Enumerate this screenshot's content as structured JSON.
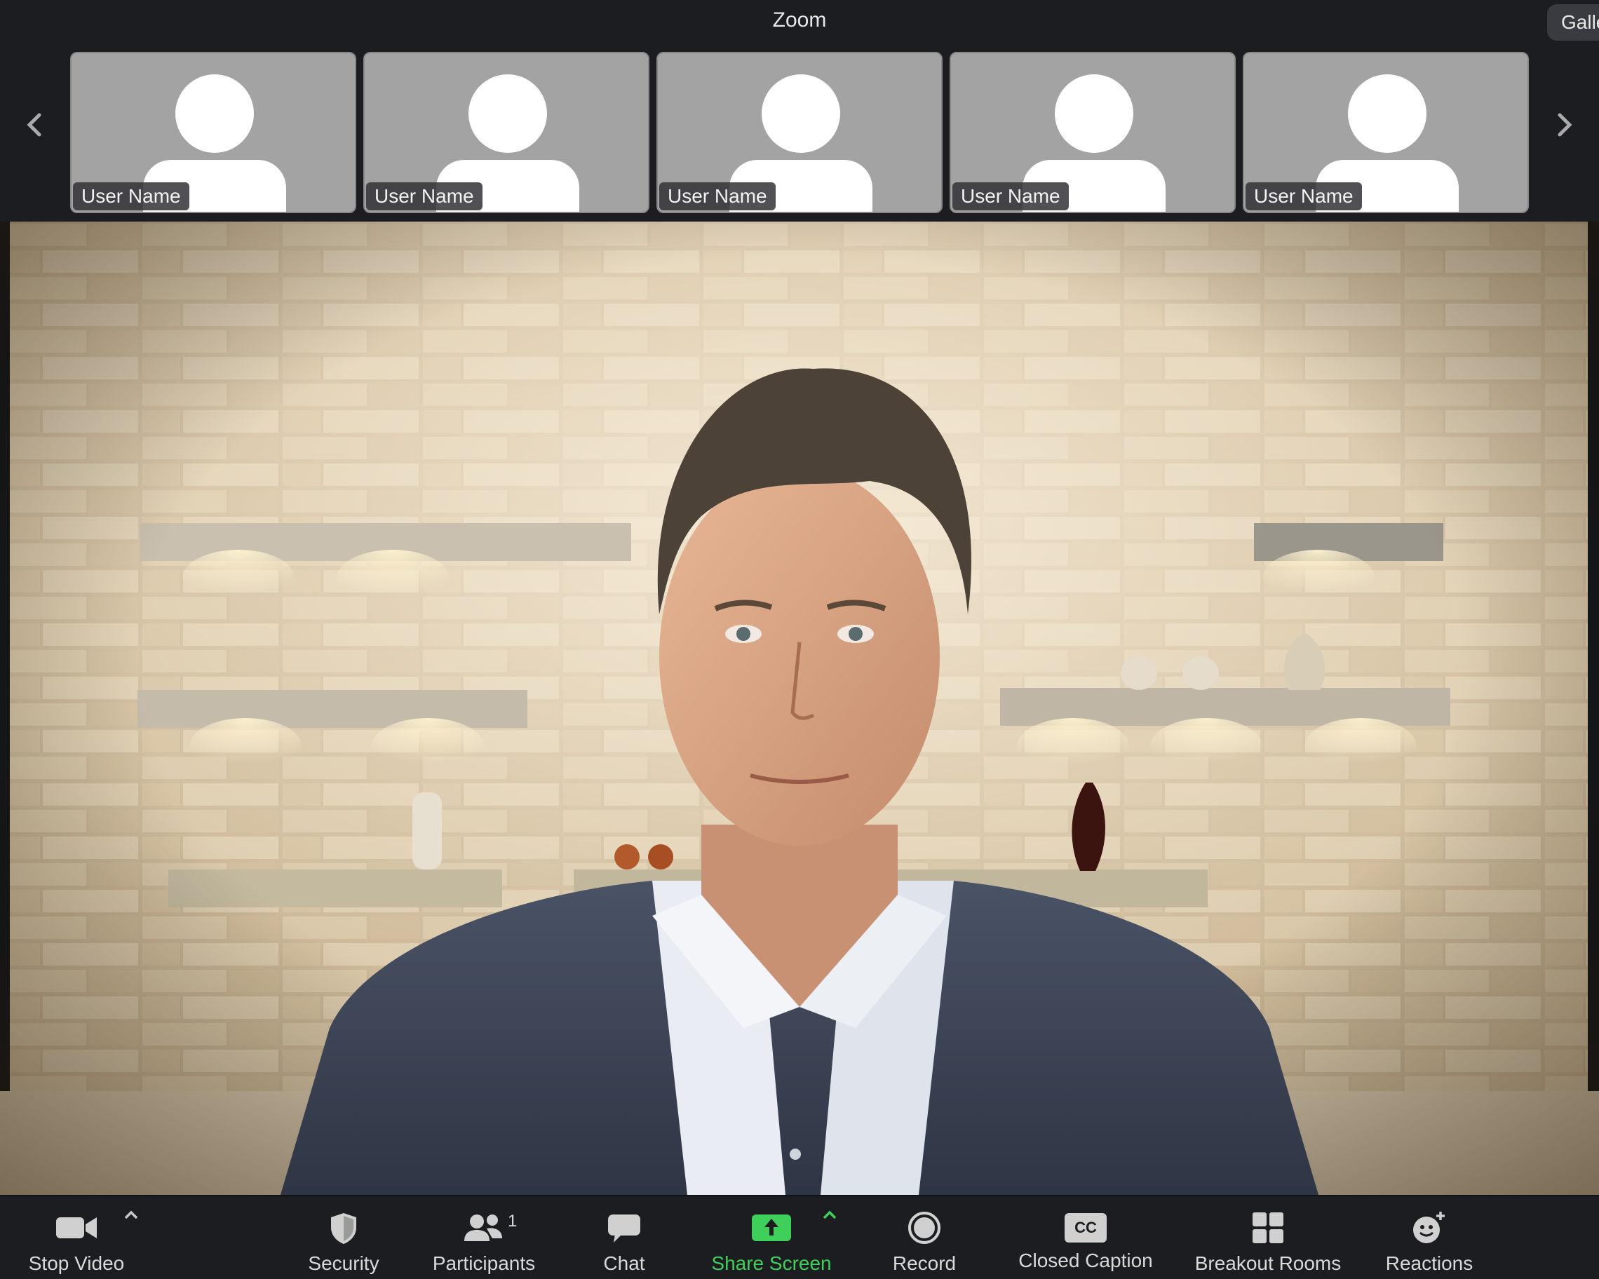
{
  "window": {
    "title": "Zoom",
    "view_button": "Gallery View"
  },
  "strip": {
    "participants": [
      {
        "name": "User Name"
      },
      {
        "name": "User Name"
      },
      {
        "name": "User Name"
      },
      {
        "name": "User Name"
      },
      {
        "name": "User Name"
      }
    ]
  },
  "toolbar": {
    "stop_video": "Stop Video",
    "security": "Security",
    "participants": "Participants",
    "participants_count": "1",
    "chat": "Chat",
    "share_screen": "Share Screen",
    "record": "Record",
    "closed_caption": "Closed Caption",
    "closed_caption_icon_text": "CC",
    "breakout_rooms": "Breakout Rooms",
    "reactions": "Reactions"
  },
  "colors": {
    "share_green": "#3ed05a",
    "bar_bg": "#1c1d21",
    "tile_bg": "#a3a3a3"
  }
}
